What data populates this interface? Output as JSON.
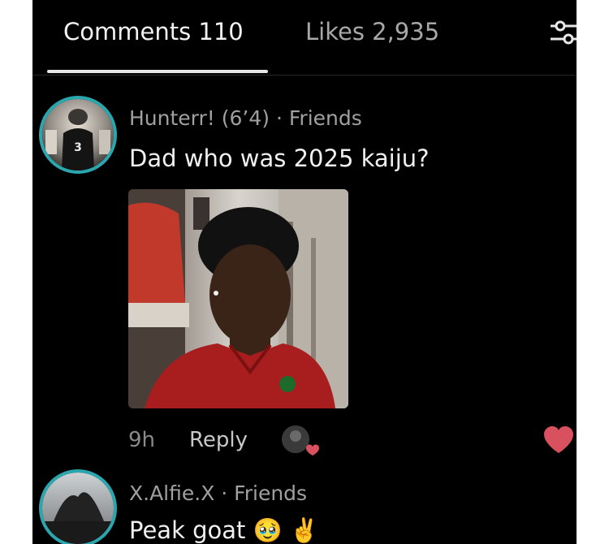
{
  "tabs": {
    "comments_label": "Comments 110",
    "likes_label": "Likes 2,935"
  },
  "icons": {
    "filter": "filter-sliders-icon",
    "heart": "heart-icon"
  },
  "colors": {
    "background": "#000000",
    "avatar_ring": "#2aa6ae",
    "heart": "#d9505f"
  },
  "comments": [
    {
      "author_line": "Hunterr! (6’4) · Friends",
      "text": "Dad who was 2025 kaiju?",
      "avatar_jersey_number": "3",
      "time": "9h",
      "reply_label": "Reply"
    },
    {
      "author_line": "X.Alfie.X · Friends",
      "text": "Peak goat 🥹 ✌️",
      "avatar_caption": "x-alfie-x"
    }
  ]
}
